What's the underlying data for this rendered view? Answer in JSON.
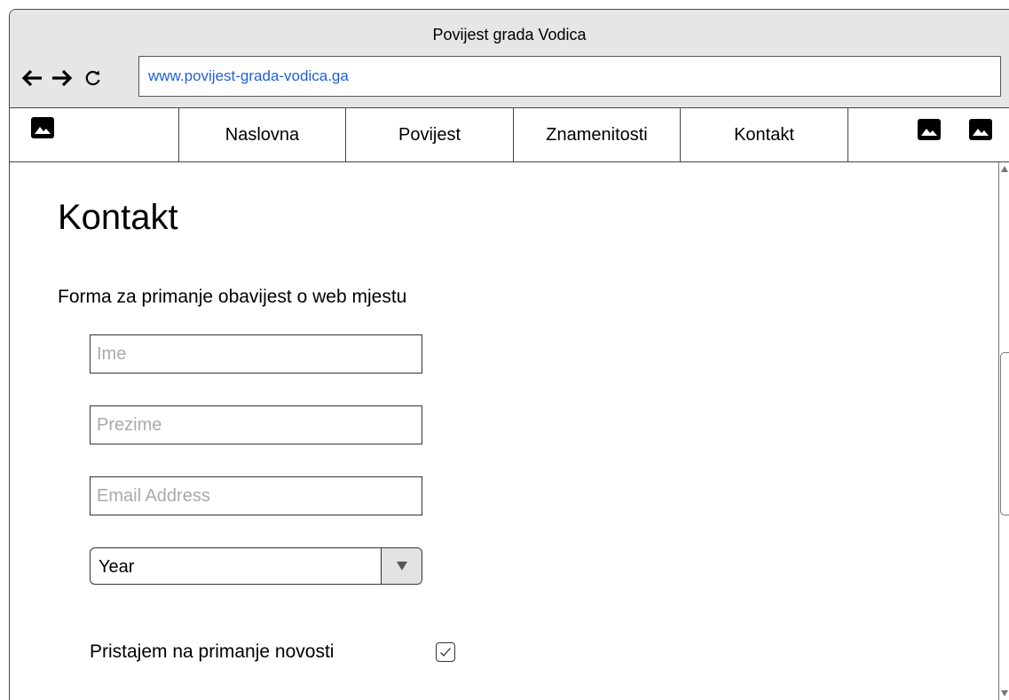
{
  "window": {
    "title": "Povijest grada Vodica",
    "url": "www.povijest-grada-vodica.ga"
  },
  "icons": {
    "back": "arrow-left-icon",
    "forward": "arrow-right-icon",
    "reload": "reload-icon",
    "logo": "image-icon",
    "header_right_1": "image-icon",
    "header_right_2": "image-icon"
  },
  "nav": {
    "items": [
      {
        "label": "Naslovna"
      },
      {
        "label": "Povijest"
      },
      {
        "label": "Znamenitosti"
      },
      {
        "label": "Kontakt"
      }
    ]
  },
  "main": {
    "page_title": "Kontakt",
    "form_description": "Forma za primanje obavijest o web mjestu",
    "fields": {
      "first_name_placeholder": "Ime",
      "last_name_placeholder": "Prezime",
      "email_placeholder": "Email Address"
    },
    "year_select": {
      "selected": "Year"
    },
    "newsletter": {
      "label": "Pristajem na primanje novosti",
      "checked": true
    }
  },
  "colors": {
    "titlebar": "#e6e6e6",
    "url_text": "#1f5fd6",
    "placeholder": "#aaaaaa"
  }
}
